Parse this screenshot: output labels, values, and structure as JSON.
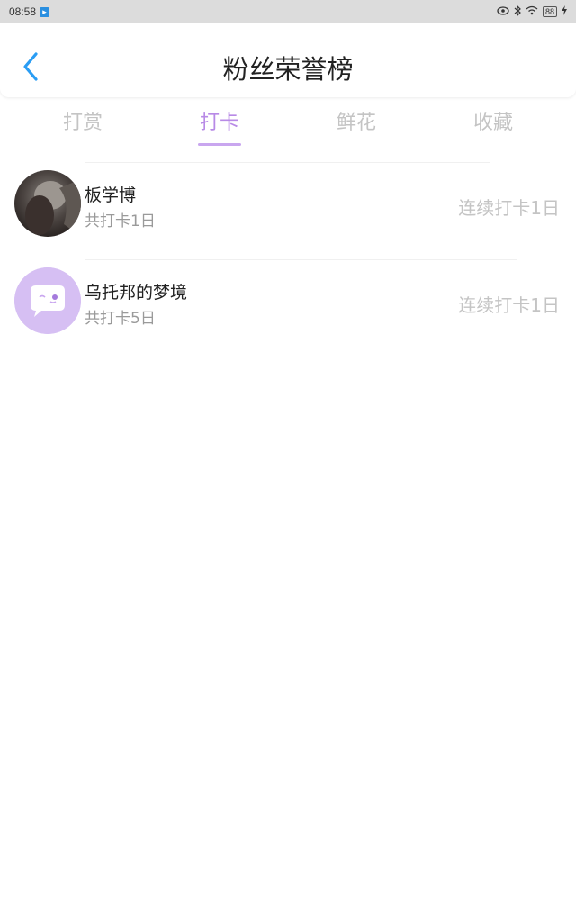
{
  "status_bar": {
    "time": "08:58",
    "battery": "88"
  },
  "header": {
    "title": "粉丝荣誉榜"
  },
  "tabs": [
    {
      "label": "打赏"
    },
    {
      "label": "打卡"
    },
    {
      "label": "鲜花"
    },
    {
      "label": "收藏"
    }
  ],
  "active_tab": "打卡",
  "list": [
    {
      "name": "板学博",
      "total": "共打卡1日",
      "streak": "连续打卡1日"
    },
    {
      "name": "乌托邦的梦境",
      "total": "共打卡5日",
      "streak": "连续打卡1日"
    }
  ],
  "colors": {
    "accent": "#b88ae6",
    "back_arrow": "#2a9df4",
    "status_bar_bg": "#dcdcdc"
  }
}
